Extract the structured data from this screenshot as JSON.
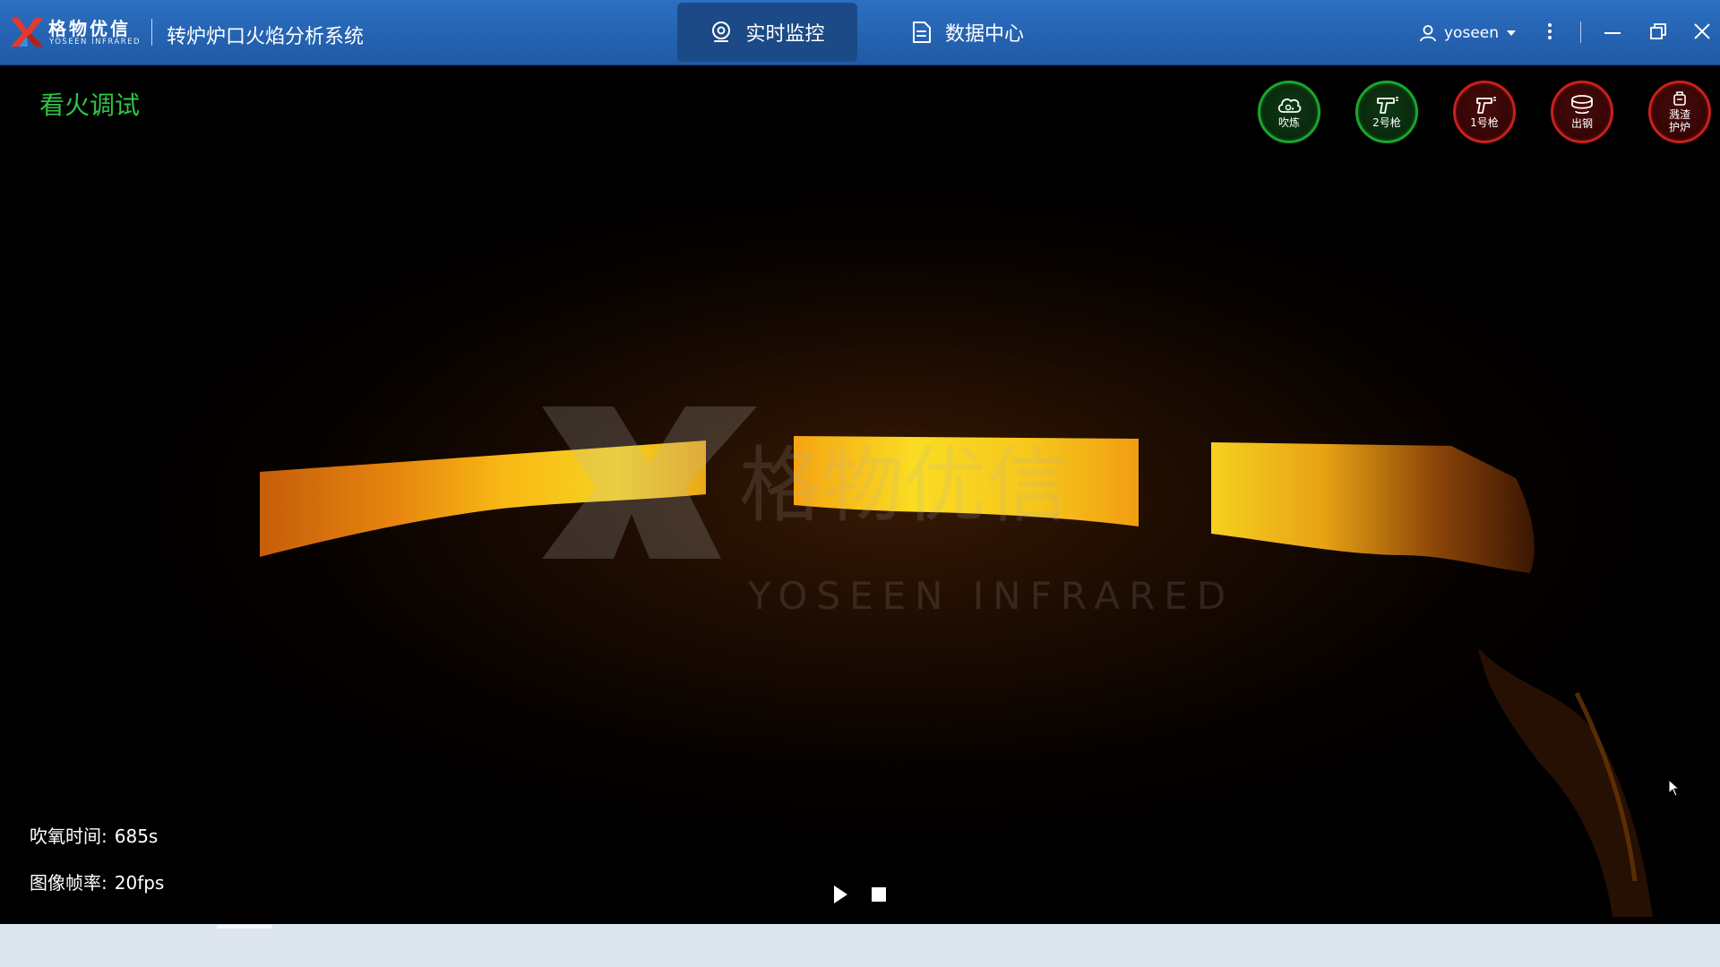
{
  "header": {
    "logo_cn": "格物优信",
    "logo_en": "YOSEEN INFRARED",
    "app_title": "转炉炉口火焰分析系统",
    "tabs": [
      {
        "label": "实时监控",
        "icon": "monitor-camera-icon",
        "active": true
      },
      {
        "label": "数据中心",
        "icon": "document-icon",
        "active": false
      }
    ],
    "user": {
      "name": "yoseen",
      "icon": "user-icon"
    },
    "window_controls": [
      "more-vertical-icon",
      "minimize-icon",
      "restore-icon",
      "close-icon"
    ]
  },
  "video": {
    "mode_label": "看火调试",
    "watermark": {
      "cn": "格物优信",
      "en": "YOSEEN INFRARED"
    },
    "status_buttons": [
      {
        "label": "吹炼",
        "state": "green",
        "icon": "oxygen-cloud-icon"
      },
      {
        "label": "2号枪",
        "state": "green",
        "icon": "lance-2-icon"
      },
      {
        "label": "1号枪",
        "state": "red",
        "icon": "lance-1-icon"
      },
      {
        "label": "出钢",
        "state": "red",
        "icon": "tapping-ladle-icon"
      },
      {
        "label_lines": [
          "溅渣",
          "护炉"
        ],
        "state": "red",
        "icon": "slag-splash-icon"
      }
    ],
    "info": {
      "oxygen_time_label": "吹氧时间:",
      "oxygen_time_value": "685s",
      "frame_rate_label": "图像帧率:",
      "frame_rate_value": "20fps"
    },
    "controls": [
      "play-icon",
      "stop-icon"
    ]
  },
  "colors": {
    "header_bg": "#2566b5",
    "active_tab_bg": "#1b4a86",
    "mode_label": "#2ec445",
    "status_green": "#1aa52d",
    "status_red": "#c8201e",
    "bottom_strip": "#dde6ee"
  }
}
